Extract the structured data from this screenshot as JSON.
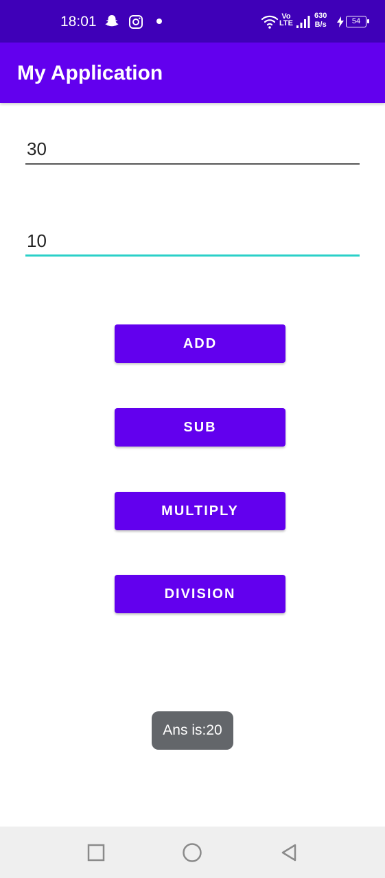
{
  "status_bar": {
    "time": "18:01",
    "icons": [
      "snapchat-icon",
      "instagram-icon",
      "notification-dot",
      "wifi-icon",
      "volte-icon",
      "signal-icon",
      "charging-icon",
      "battery-icon"
    ],
    "volte_top": "Vo",
    "volte_bottom": "LTE",
    "net_speed_value": "630",
    "net_speed_unit": "B/s",
    "battery_level": "54"
  },
  "app_bar": {
    "title": "My Application",
    "color": "#6200ee"
  },
  "inputs": {
    "first_number": "30",
    "second_number": "10",
    "focus_color": "#2ad0c8"
  },
  "buttons": {
    "add": "ADD",
    "sub": "SUB",
    "multiply": "MULTIPLY",
    "division": "DIVISION",
    "color": "#6200ee"
  },
  "toast": {
    "message": "Ans is:20"
  },
  "nav_bar": {
    "icons": [
      "recents-square-icon",
      "home-circle-icon",
      "back-triangle-icon"
    ]
  }
}
